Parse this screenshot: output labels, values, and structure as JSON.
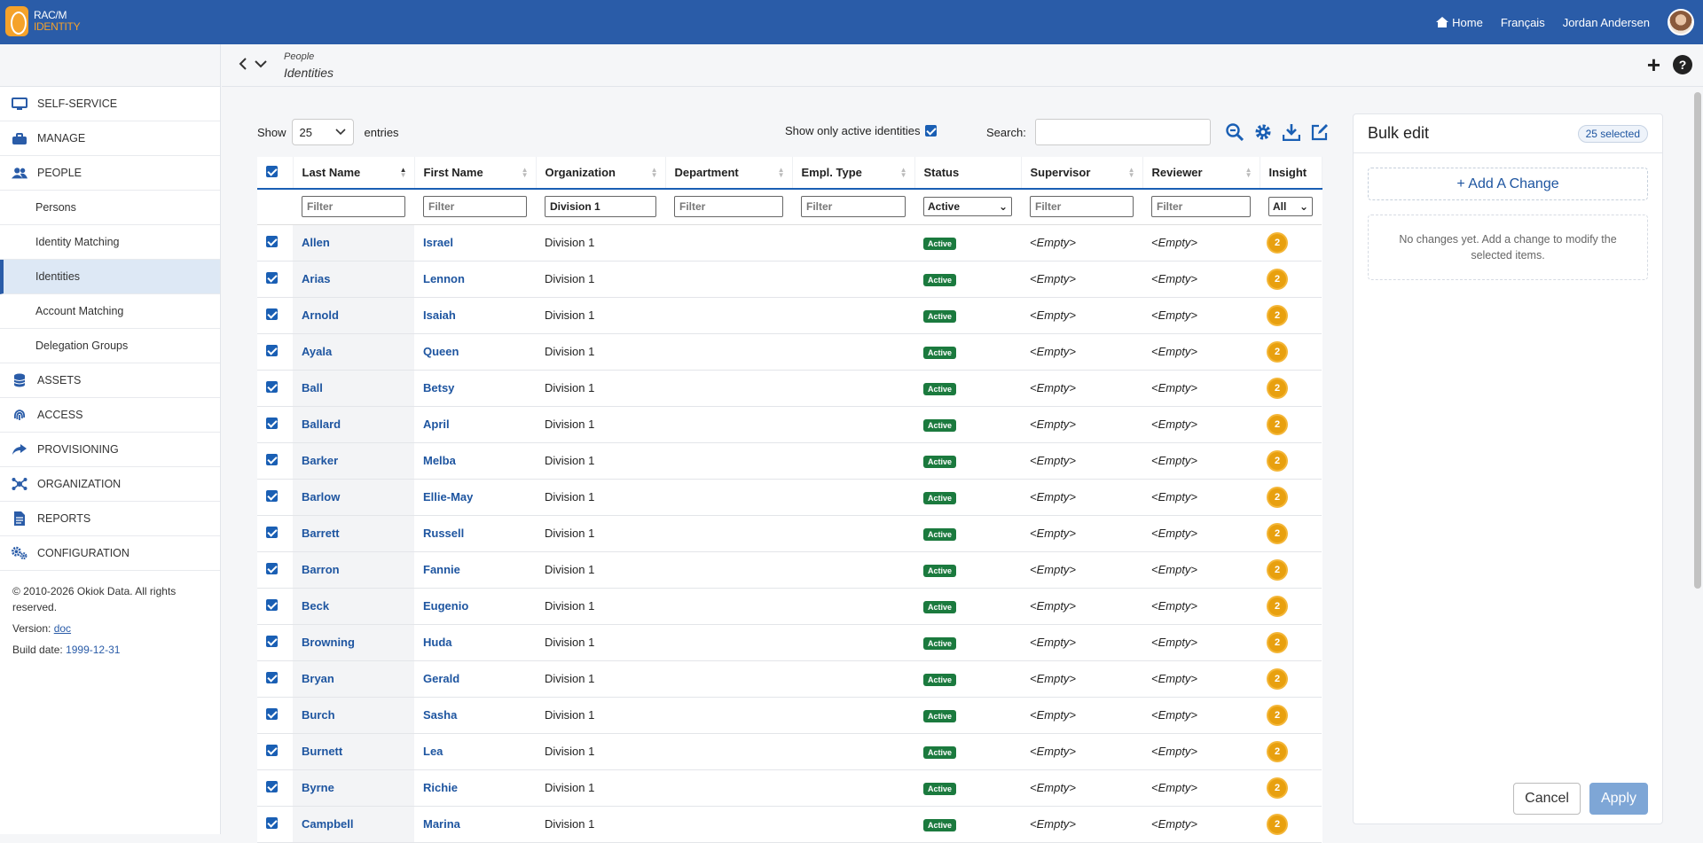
{
  "brand": {
    "line1": "RAC/M",
    "line2": "IDENTITY"
  },
  "topnav": {
    "home": "Home",
    "language": "Français",
    "user": "Jordan Andersen"
  },
  "breadcrumb": {
    "parent": "People",
    "current": "Identities"
  },
  "sidebar": {
    "items": [
      {
        "label": "SELF-SERVICE",
        "icon": "monitor-icon",
        "sub": false
      },
      {
        "label": "MANAGE",
        "icon": "toolbox-icon",
        "sub": false
      },
      {
        "label": "PEOPLE",
        "icon": "people-icon",
        "sub": false
      },
      {
        "label": "Persons",
        "sub": true
      },
      {
        "label": "Identity Matching",
        "sub": true
      },
      {
        "label": "Identities",
        "sub": true,
        "active": true
      },
      {
        "label": "Account Matching",
        "sub": true
      },
      {
        "label": "Delegation Groups",
        "sub": true
      },
      {
        "label": "ASSETS",
        "icon": "database-icon",
        "sub": false
      },
      {
        "label": "ACCESS",
        "icon": "fingerprint-icon",
        "sub": false
      },
      {
        "label": "PROVISIONING",
        "icon": "share-icon",
        "sub": false
      },
      {
        "label": "ORGANIZATION",
        "icon": "network-icon",
        "sub": false
      },
      {
        "label": "REPORTS",
        "icon": "report-icon",
        "sub": false
      },
      {
        "label": "CONFIGURATION",
        "icon": "gears-icon",
        "sub": false
      }
    ],
    "footer": {
      "copyright": "© 2010-2026 Okiok Data. All rights reserved.",
      "version_label": "Version:",
      "version_link": "doc",
      "build_label": "Build date:",
      "build_date": "1999-12-31"
    }
  },
  "controls": {
    "show_label": "Show",
    "entries_value": "25",
    "entries_label": "entries",
    "active_only_label": "Show only active identities",
    "search_label": "Search:"
  },
  "table": {
    "columns": [
      "Last Name",
      "First Name",
      "Organization",
      "Department",
      "Empl. Type",
      "Status",
      "Supervisor",
      "Reviewer",
      "Insight"
    ],
    "filters": {
      "placeholder": "Filter",
      "organization": "Division 1",
      "status": "Active",
      "insight": "All"
    },
    "rows": [
      {
        "last": "Allen",
        "first": "Israel",
        "org": "Division 1",
        "status": "Active",
        "supervisor": "<Empty>",
        "reviewer": "<Empty>",
        "insight": "2"
      },
      {
        "last": "Arias",
        "first": "Lennon",
        "org": "Division 1",
        "status": "Active",
        "supervisor": "<Empty>",
        "reviewer": "<Empty>",
        "insight": "2"
      },
      {
        "last": "Arnold",
        "first": "Isaiah",
        "org": "Division 1",
        "status": "Active",
        "supervisor": "<Empty>",
        "reviewer": "<Empty>",
        "insight": "2"
      },
      {
        "last": "Ayala",
        "first": "Queen",
        "org": "Division 1",
        "status": "Active",
        "supervisor": "<Empty>",
        "reviewer": "<Empty>",
        "insight": "2"
      },
      {
        "last": "Ball",
        "first": "Betsy",
        "org": "Division 1",
        "status": "Active",
        "supervisor": "<Empty>",
        "reviewer": "<Empty>",
        "insight": "2"
      },
      {
        "last": "Ballard",
        "first": "April",
        "org": "Division 1",
        "status": "Active",
        "supervisor": "<Empty>",
        "reviewer": "<Empty>",
        "insight": "2"
      },
      {
        "last": "Barker",
        "first": "Melba",
        "org": "Division 1",
        "status": "Active",
        "supervisor": "<Empty>",
        "reviewer": "<Empty>",
        "insight": "2"
      },
      {
        "last": "Barlow",
        "first": "Ellie-May",
        "org": "Division 1",
        "status": "Active",
        "supervisor": "<Empty>",
        "reviewer": "<Empty>",
        "insight": "2"
      },
      {
        "last": "Barrett",
        "first": "Russell",
        "org": "Division 1",
        "status": "Active",
        "supervisor": "<Empty>",
        "reviewer": "<Empty>",
        "insight": "2"
      },
      {
        "last": "Barron",
        "first": "Fannie",
        "org": "Division 1",
        "status": "Active",
        "supervisor": "<Empty>",
        "reviewer": "<Empty>",
        "insight": "2"
      },
      {
        "last": "Beck",
        "first": "Eugenio",
        "org": "Division 1",
        "status": "Active",
        "supervisor": "<Empty>",
        "reviewer": "<Empty>",
        "insight": "2"
      },
      {
        "last": "Browning",
        "first": "Huda",
        "org": "Division 1",
        "status": "Active",
        "supervisor": "<Empty>",
        "reviewer": "<Empty>",
        "insight": "2"
      },
      {
        "last": "Bryan",
        "first": "Gerald",
        "org": "Division 1",
        "status": "Active",
        "supervisor": "<Empty>",
        "reviewer": "<Empty>",
        "insight": "2"
      },
      {
        "last": "Burch",
        "first": "Sasha",
        "org": "Division 1",
        "status": "Active",
        "supervisor": "<Empty>",
        "reviewer": "<Empty>",
        "insight": "2"
      },
      {
        "last": "Burnett",
        "first": "Lea",
        "org": "Division 1",
        "status": "Active",
        "supervisor": "<Empty>",
        "reviewer": "<Empty>",
        "insight": "2"
      },
      {
        "last": "Byrne",
        "first": "Richie",
        "org": "Division 1",
        "status": "Active",
        "supervisor": "<Empty>",
        "reviewer": "<Empty>",
        "insight": "2"
      },
      {
        "last": "Campbell",
        "first": "Marina",
        "org": "Division 1",
        "status": "Active",
        "supervisor": "<Empty>",
        "reviewer": "<Empty>",
        "insight": "2"
      }
    ]
  },
  "bulk": {
    "title": "Bulk edit",
    "selected": "25 selected",
    "add_change": "+ Add A Change",
    "empty_text": "No changes yet. Add a change to modify the selected items.",
    "cancel": "Cancel",
    "apply": "Apply"
  },
  "colors": {
    "brand_blue": "#2a5ca8",
    "brand_orange": "#f5a22a",
    "active_green": "#1b7a3e",
    "insight_gold": "#e8a00f"
  }
}
